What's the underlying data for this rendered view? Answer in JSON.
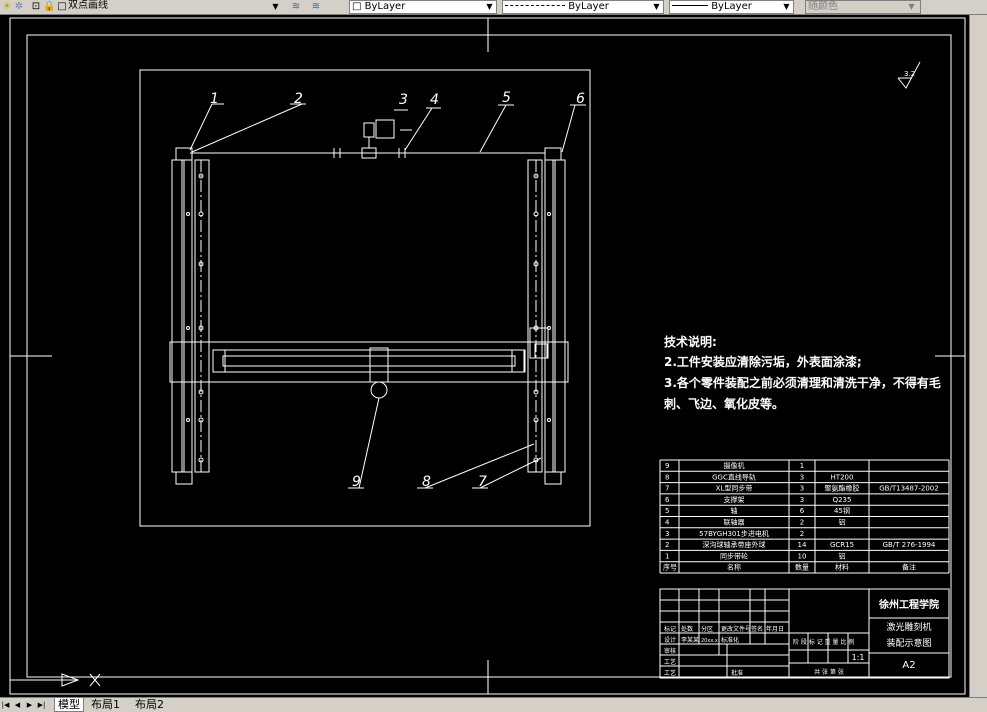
{
  "toolbar": {
    "layer_name": "双点画线",
    "color_value": "ByLayer",
    "linetype_value": "ByLayer",
    "lineweight_value": "ByLayer",
    "plotstyle_value": "随颜色"
  },
  "drawing": {
    "balloons": [
      "1",
      "2",
      "3",
      "4",
      "5",
      "6",
      "7",
      "8",
      "9"
    ],
    "roughness_symbol": "3.2",
    "tech_notes": {
      "title": "技术说明:",
      "line1": "2.工件安装应清除污垢，外表面涂漆;",
      "line2": "3.各个零件装配之前必须清理和清洗干净，不得有毛",
      "line3": "刺、飞边、氧化皮等。"
    },
    "bom": [
      {
        "no": "9",
        "name": "摄像机",
        "qty": "1",
        "material": "",
        "standard": ""
      },
      {
        "no": "8",
        "name": "GGC直线导轨",
        "qty": "3",
        "material": "HT200",
        "standard": ""
      },
      {
        "no": "7",
        "name": "XL型同步带",
        "qty": "3",
        "material": "聚氨酯橡胶",
        "standard": "GB/T13487-2002"
      },
      {
        "no": "6",
        "name": "支撑架",
        "qty": "3",
        "material": "Q235",
        "standard": ""
      },
      {
        "no": "5",
        "name": "轴",
        "qty": "6",
        "material": "45钢",
        "standard": ""
      },
      {
        "no": "4",
        "name": "联轴器",
        "qty": "2",
        "material": "铝",
        "standard": ""
      },
      {
        "no": "3",
        "name": "57BYGH301步进电机",
        "qty": "2",
        "material": "",
        "standard": ""
      },
      {
        "no": "2",
        "name": "深沟球轴承带座外球",
        "qty": "14",
        "material": "GCR15",
        "standard": "GB/T 276-1994"
      },
      {
        "no": "1",
        "name": "同步带轮",
        "qty": "10",
        "material": "铝",
        "standard": ""
      }
    ],
    "bom_header": {
      "no": "序号",
      "name": "名称",
      "qty": "数量",
      "material": "材料",
      "remark": "备注"
    },
    "title_block": {
      "school": "徐州工程学院",
      "title_line1": "激光雕刻机",
      "title_line2": "装配示意图",
      "scale": "1:1",
      "sheet": "A2",
      "stage_labels": "阶 段 标 记     重 量   比 例",
      "sheets_label": "共   张   第   张",
      "row_labels": [
        "标记",
        "处数",
        "分区",
        "更改文件号",
        "签名",
        "年月日"
      ],
      "design": "设计",
      "design_name": "李某某",
      "design_date": "20xx.x",
      "std": "标准化",
      "check": "审核",
      "process": "工艺",
      "approve": "批准"
    }
  },
  "tabs": [
    {
      "label": "模型"
    },
    {
      "label": "布局1"
    },
    {
      "label": "布局2"
    }
  ],
  "colors": {
    "background": "#000000",
    "line": "#ffffff",
    "ui": "#d4d0c8"
  }
}
